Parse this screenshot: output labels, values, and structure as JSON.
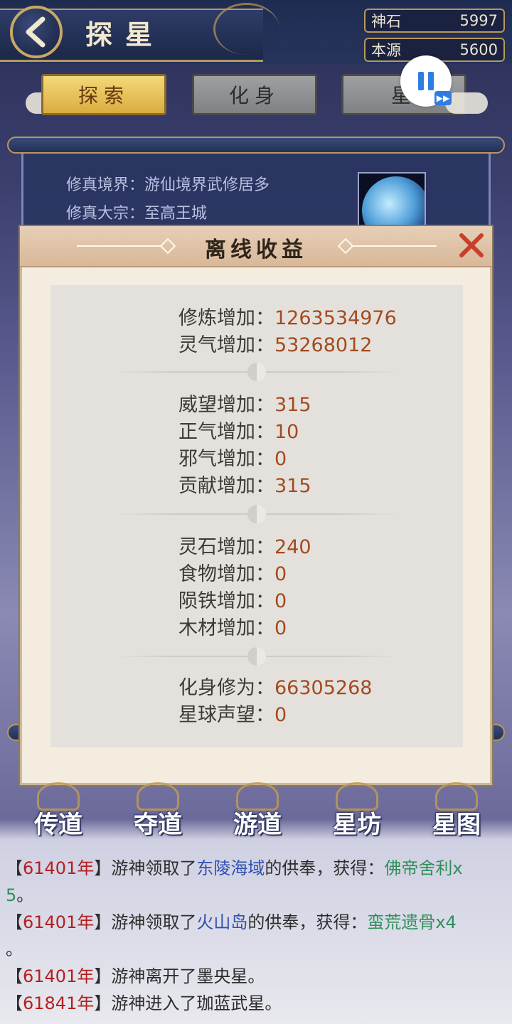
{
  "header": {
    "title": "探星",
    "currencies": [
      {
        "label": "神石",
        "value": "5997"
      },
      {
        "label": "本源",
        "value": "5600"
      }
    ]
  },
  "tabs": [
    {
      "label": "探索",
      "active": true
    },
    {
      "label": "化身",
      "active": false
    },
    {
      "label": "星",
      "active": false
    }
  ],
  "info": {
    "realm_label": "修真境界：",
    "realm_value": "游仙境界武修居多",
    "sect_label": "修真大宗：",
    "sect_value": "至高王城"
  },
  "dialog": {
    "title": "离线收益",
    "groups": [
      [
        {
          "label": "修炼增加：",
          "value": "1263534976"
        },
        {
          "label": "灵气增加：",
          "value": "53268012"
        }
      ],
      [
        {
          "label": "威望增加：",
          "value": "315"
        },
        {
          "label": "正气增加：",
          "value": "10"
        },
        {
          "label": "邪气增加：",
          "value": "0"
        },
        {
          "label": "贡献增加：",
          "value": "315"
        }
      ],
      [
        {
          "label": "灵石增加：",
          "value": "240"
        },
        {
          "label": "食物增加：",
          "value": "0"
        },
        {
          "label": "陨铁增加：",
          "value": "0"
        },
        {
          "label": "木材增加：",
          "value": "0"
        }
      ],
      [
        {
          "label": "化身修为：",
          "value": "66305268"
        },
        {
          "label": "星球声望：",
          "value": "0"
        }
      ]
    ]
  },
  "nav": [
    "传道",
    "夺道",
    "游道",
    "星坊",
    "星图"
  ],
  "log": [
    {
      "pre": "【",
      "year": "61401年",
      "mid": "】游神领取了",
      "place": "东陵海域",
      "post": "的供奉，获得：",
      "item": "佛帝舍利x",
      "wrap_item": "5",
      "tail": "。"
    },
    {
      "pre": "【",
      "year": "61401年",
      "mid": "】游神领取了",
      "place": "火山岛",
      "post": "的供奉，获得：",
      "item": "蛮荒遗骨x4",
      "wrap_item": "",
      "tail": "。"
    },
    {
      "pre": "【",
      "year": "61401年",
      "mid": "】游神离开了墨央星。"
    },
    {
      "pre": "【",
      "year": "61841年",
      "mid": "】游神进入了珈蓝武星。"
    }
  ],
  "colors": {
    "value_text": "#a34a1f",
    "year_text": "#b32020",
    "place_text": "#2f50b0",
    "item_text": "#2f8f5a",
    "active_tab": "#f4d87a"
  },
  "icons": [
    "back-arrow-icon",
    "pause-icon",
    "fast-forward-icon",
    "close-x-icon",
    "yin-yang-icon"
  ]
}
